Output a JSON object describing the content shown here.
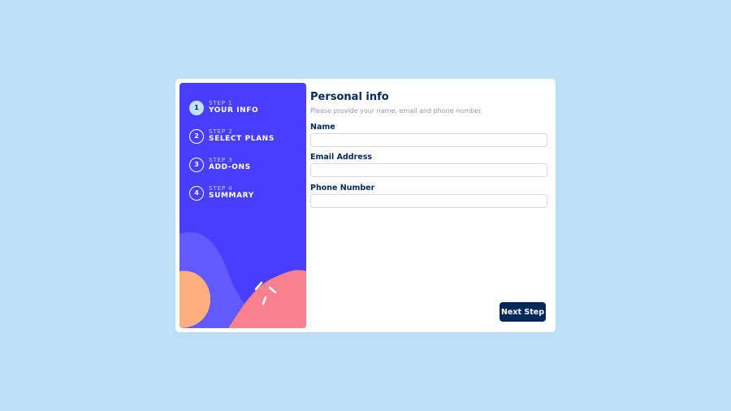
{
  "steps": [
    {
      "number": "1",
      "step_label": "STEP 1",
      "title": "YOUR INFO",
      "active": true
    },
    {
      "number": "2",
      "step_label": "STEP 2",
      "title": "SELECT PLANS",
      "active": false
    },
    {
      "number": "3",
      "step_label": "STEP 3",
      "title": "ADD-ONS",
      "active": false
    },
    {
      "number": "4",
      "step_label": "STEP 4",
      "title": "SUMMARY",
      "active": false
    }
  ],
  "form": {
    "title": "Personal info",
    "subtitle": "Please provide your name, email and phone number.",
    "fields": [
      {
        "label": "Name",
        "value": "",
        "placeholder": ""
      },
      {
        "label": "Email Address",
        "value": "",
        "placeholder": ""
      },
      {
        "label": "Phone Number",
        "value": "",
        "placeholder": ""
      }
    ],
    "next_label": "Next Step"
  },
  "colors": {
    "background": "#bfe2fb",
    "sidebar": "#483eff",
    "active_step": "#bfe2fd",
    "primary_text": "#02295a",
    "button": "#022959",
    "art_orange": "#ffaf7e",
    "art_pink": "#f9818e",
    "art_violet": "#6259ff"
  }
}
